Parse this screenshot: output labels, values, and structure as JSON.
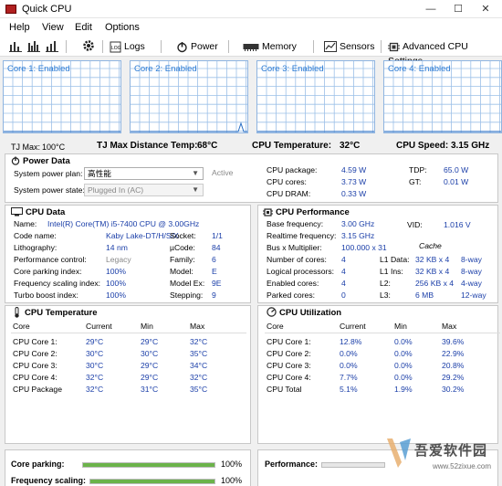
{
  "window": {
    "title": "Quick CPU",
    "minimize": "—",
    "maximize": "☐",
    "close": "✕"
  },
  "menu": [
    "Help",
    "View",
    "Edit",
    "Options"
  ],
  "toolbar": {
    "logs": "Logs",
    "power": "Power",
    "memory": "Memory",
    "sensors": "Sensors",
    "advanced": "Advanced CPU Settings"
  },
  "graphs": [
    "Core 1: Enabled",
    "Core 2: Enabled",
    "Core 3: Enabled",
    "Core 4: Enabled"
  ],
  "status": {
    "tjmax_label": "TJ Max:",
    "tjmax_value": "100°C",
    "tjdist_label": "TJ Max Distance Temp:",
    "tjdist_value": "68°C",
    "cputemp_label": "CPU Temperature:",
    "cputemp_value": "32°C",
    "cpuspeed_label": "CPU Speed:",
    "cpuspeed_value": "3.15 GHz"
  },
  "power": {
    "title": "Power Data",
    "plan_label": "System power plan:",
    "plan_value": "高性能",
    "plan_status": "Active",
    "state_label": "System power state:",
    "state_value": "Plugged In (AC)",
    "rows": [
      {
        "label": "CPU package:",
        "value": "4.59 W",
        "label2": "TDP:",
        "value2": "65.0 W"
      },
      {
        "label": "CPU cores:",
        "value": "3.73 W",
        "label2": "GT:",
        "value2": "0.01 W"
      },
      {
        "label": "CPU DRAM:",
        "value": "0.33 W",
        "label2": "",
        "value2": ""
      }
    ]
  },
  "cpudata": {
    "title": "CPU Data",
    "name_label": "Name:",
    "name_value": "Intel(R) Core(TM) i5-7400 CPU @ 3.00GHz",
    "rows": [
      {
        "l": "Code name:",
        "v": "Kaby Lake-DT/H/S/X",
        "l2": "Socket:",
        "v2": "1/1"
      },
      {
        "l": "Lithography:",
        "v": "14 nm",
        "l2": "µCode:",
        "v2": "84"
      },
      {
        "l": "Performance control:",
        "v": "Legacy",
        "l2": "Family:",
        "v2": "6"
      },
      {
        "l": "Core parking index:",
        "v": "100%",
        "l2": "Model:",
        "v2": "E"
      },
      {
        "l": "Frequency scaling index:",
        "v": "100%",
        "l2": "Model Ex:",
        "v2": "9E"
      },
      {
        "l": "Turbo boost index:",
        "v": "100%",
        "l2": "Stepping:",
        "v2": "9"
      }
    ]
  },
  "perf": {
    "title": "CPU Performance",
    "base_label": "Base frequency:",
    "base_value": "3.00 GHz",
    "vid_label": "VID:",
    "vid_value": "1.016 V",
    "real_label": "Realtime frequency:",
    "real_value": "3.15 GHz",
    "bus_label": "Bus x Multiplier:",
    "bus_value": "100.000 x 31",
    "cache_label": "Cache",
    "rows": [
      {
        "l": "Number of cores:",
        "v": "4",
        "cl": "L1 Data:",
        "cv": "32 KB x 4",
        "cw": "8-way"
      },
      {
        "l": "Logical processors:",
        "v": "4",
        "cl": "L1 Ins:",
        "cv": "32 KB x 4",
        "cw": "8-way"
      },
      {
        "l": "Enabled cores:",
        "v": "4",
        "cl": "L2:",
        "cv": "256 KB x 4",
        "cw": "4-way"
      },
      {
        "l": "Parked cores:",
        "v": "0",
        "cl": "L3:",
        "cv": "6 MB",
        "cw": "12-way"
      }
    ]
  },
  "temp": {
    "title": "CPU Temperature",
    "headers": [
      "Core",
      "Current",
      "Min",
      "Max"
    ],
    "rows": [
      [
        "CPU Core 1:",
        "29°C",
        "29°C",
        "32°C"
      ],
      [
        "CPU Core 2:",
        "30°C",
        "30°C",
        "35°C"
      ],
      [
        "CPU Core 3:",
        "30°C",
        "29°C",
        "34°C"
      ],
      [
        "CPU Core 4:",
        "32°C",
        "29°C",
        "32°C"
      ],
      [
        "CPU Package",
        "32°C",
        "31°C",
        "35°C"
      ]
    ]
  },
  "util": {
    "title": "CPU Utilization",
    "headers": [
      "Core",
      "Current",
      "Min",
      "Max"
    ],
    "rows": [
      [
        "CPU Core 1:",
        "12.8%",
        "0.0%",
        "39.6%"
      ],
      [
        "CPU Core 2:",
        "0.0%",
        "0.0%",
        "22.9%"
      ],
      [
        "CPU Core 3:",
        "0.0%",
        "0.0%",
        "20.8%"
      ],
      [
        "CPU Core 4:",
        "7.7%",
        "0.0%",
        "29.2%"
      ],
      [
        "CPU Total",
        "5.1%",
        "1.9%",
        "30.2%"
      ]
    ]
  },
  "bottom": {
    "parking_label": "Core parking:",
    "parking_value": "100%",
    "parking_fill": 1.0,
    "scaling_label": "Frequency scaling:",
    "scaling_value": "100%",
    "scaling_fill": 1.0,
    "performance_label": "Performance:"
  },
  "watermark": {
    "line1": "吾爱软件园",
    "line2": "www.52zixue.com"
  }
}
